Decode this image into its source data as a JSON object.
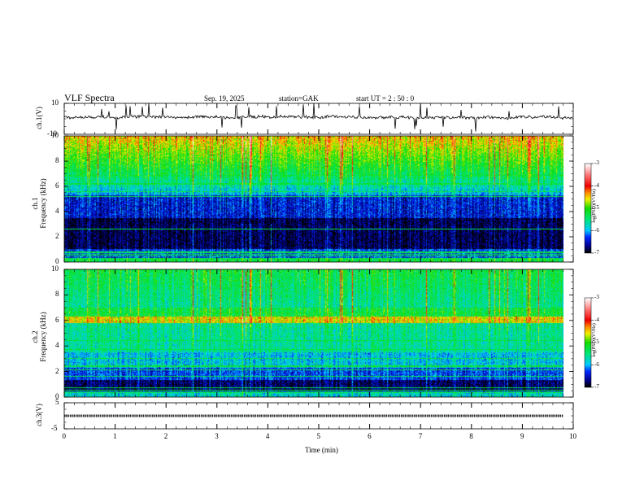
{
  "header": {
    "title": "VLF  Spectra",
    "date": "Sep. 19, 2025",
    "station": "station=GAK",
    "start_ut": "start  UT =   2 : 50 : 0"
  },
  "colors": {
    "trace": "#000000",
    "axis": "#000000"
  },
  "chart_data": [
    {
      "type": "line",
      "panel": "ch1-waveform",
      "ylabel": "ch.1(V)",
      "ylim": [
        -10,
        10
      ],
      "yticks": [
        "10",
        "-10"
      ],
      "xlim": [
        0,
        10
      ],
      "baseline": 1
    },
    {
      "type": "heatmap",
      "panel": "ch1-spectrogram",
      "ylabel": "ch.1\nFrequency  (kHz)",
      "ylabel_line1": "ch.1",
      "ylabel_line2": "Frequency  (kHz)",
      "ylim": [
        0,
        10
      ],
      "yticks": [
        "0",
        "2",
        "4",
        "6",
        "8",
        "10"
      ],
      "xlim": [
        0,
        10
      ],
      "colorbar": {
        "label": "log(PSD)(V²/Hz)",
        "range": [
          -7,
          -3
        ],
        "ticks": [
          "-3",
          "-4",
          "-5",
          "-6",
          "-7"
        ]
      }
    },
    {
      "type": "heatmap",
      "panel": "ch2-spectrogram",
      "ylabel_line1": "ch.2",
      "ylabel_line2": "Frequency  (kHz)",
      "ylim": [
        0,
        10
      ],
      "yticks": [
        "0",
        "2",
        "4",
        "6",
        "8",
        "10"
      ],
      "xlim": [
        0,
        10
      ],
      "colorbar": {
        "label": "log(PSD)(V²/Hz)",
        "range": [
          -7,
          -3
        ],
        "ticks": [
          "-3",
          "-4",
          "-5",
          "-6",
          "-7"
        ]
      }
    },
    {
      "type": "line",
      "panel": "ch3-waveform",
      "ylabel": "ch.3(V)",
      "ylim": [
        -5,
        5
      ],
      "yticks": [
        "5",
        "-5"
      ],
      "xlim": [
        0,
        10
      ],
      "baseline": 0
    }
  ],
  "xaxis": {
    "label": "Time  (min)",
    "ticks": [
      "0",
      "1",
      "2",
      "3",
      "4",
      "5",
      "6",
      "7",
      "8",
      "9",
      "10"
    ]
  }
}
